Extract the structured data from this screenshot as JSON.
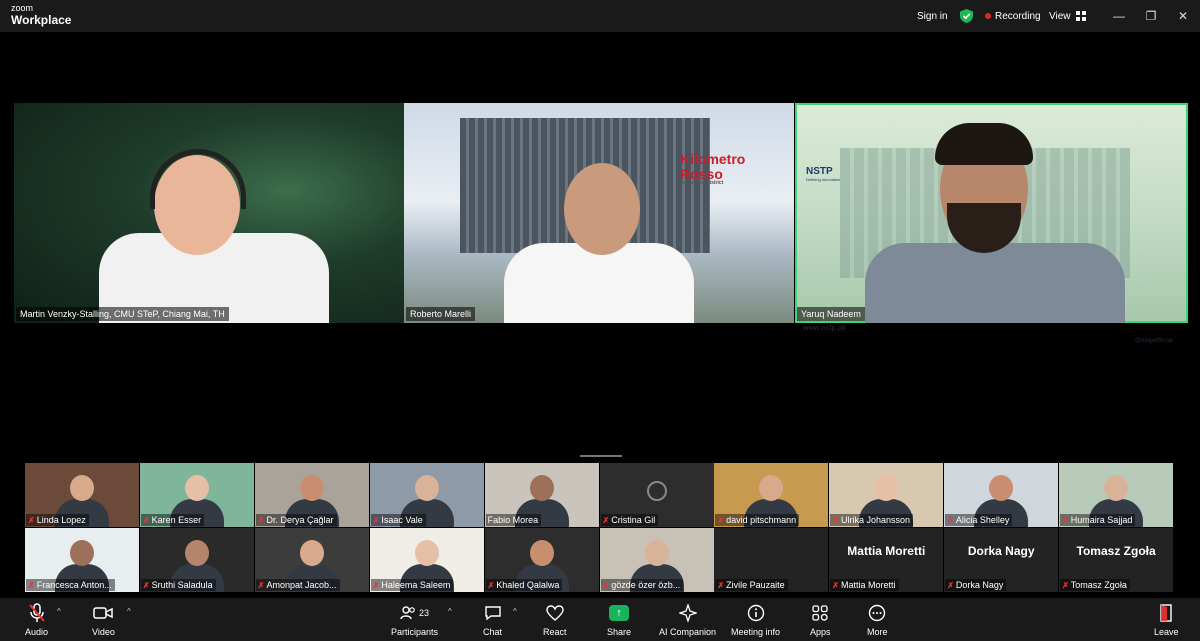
{
  "app": {
    "brand_top": "zoom",
    "brand_bottom": "Workplace",
    "sign_in": "Sign in",
    "recording": "Recording",
    "view": "View"
  },
  "speakers": [
    {
      "name": "Martin Venzky-Stalling, CMU STeP, Chiang Mai, TH"
    },
    {
      "name": "Roberto Marelli"
    },
    {
      "name": "Yaruq Nadeem"
    }
  ],
  "backgrounds": {
    "kilometro_line1": "Kilometro",
    "kilometro_line2": "Rosso",
    "kilometro_sub": "innovation district",
    "nstp": "NSTP",
    "nstp_sub": "Defining Innovation",
    "nstp_web": "www.nstp.pk",
    "nstp_social": "@nstpofficial"
  },
  "gallery": [
    {
      "name": "Linda Lopez",
      "muted": true,
      "video": true
    },
    {
      "name": "Karen Esser",
      "muted": true,
      "video": true
    },
    {
      "name": "Dr. Derya Çağlar",
      "muted": true,
      "video": true
    },
    {
      "name": "Isaac Vale",
      "muted": true,
      "video": true
    },
    {
      "name": "Fabio Morea",
      "muted": false,
      "video": true
    },
    {
      "name": "Cristina Gil",
      "muted": true,
      "video": false
    },
    {
      "name": "david pitschmann",
      "muted": true,
      "video": true
    },
    {
      "name": "Ulrika Johansson",
      "muted": true,
      "video": true
    },
    {
      "name": "Alicia Shelley",
      "muted": true,
      "video": true
    },
    {
      "name": "Humaira Sajjad",
      "muted": true,
      "video": true
    },
    {
      "name": "Francesca Anton...",
      "muted": true,
      "video": true
    },
    {
      "name": "Sruthi Saladula",
      "muted": true,
      "video": true
    },
    {
      "name": "Amonpat Jacob...",
      "muted": true,
      "video": true
    },
    {
      "name": "Haleema Saleem",
      "muted": true,
      "video": true
    },
    {
      "name": "Khaled Qalalwa",
      "muted": true,
      "video": true
    },
    {
      "name": "gözde özer özb...",
      "muted": true,
      "video": true
    },
    {
      "name": "Zivile Pauzaite",
      "muted": true,
      "video": false,
      "big": ""
    },
    {
      "name": "Mattia Moretti",
      "muted": true,
      "video": false,
      "big": "Mattia Moretti"
    },
    {
      "name": "Dorka Nagy",
      "muted": true,
      "video": false,
      "big": "Dorka Nagy"
    },
    {
      "name": "Tomasz Zgoła",
      "muted": true,
      "video": false,
      "big": "Tomasz Zgoła"
    }
  ],
  "toolbar": {
    "audio": "Audio",
    "video": "Video",
    "participants": "Participants",
    "participants_count": "23",
    "chat": "Chat",
    "react": "React",
    "share": "Share",
    "ai_companion": "AI Companion",
    "meeting_info": "Meeting info",
    "apps": "Apps",
    "more": "More",
    "leave": "Leave"
  },
  "colors": {
    "active_speaker_border": "#3fd47a",
    "recording_dot": "#e02828",
    "share_green": "#18b35a",
    "muted_red": "#e33333"
  }
}
